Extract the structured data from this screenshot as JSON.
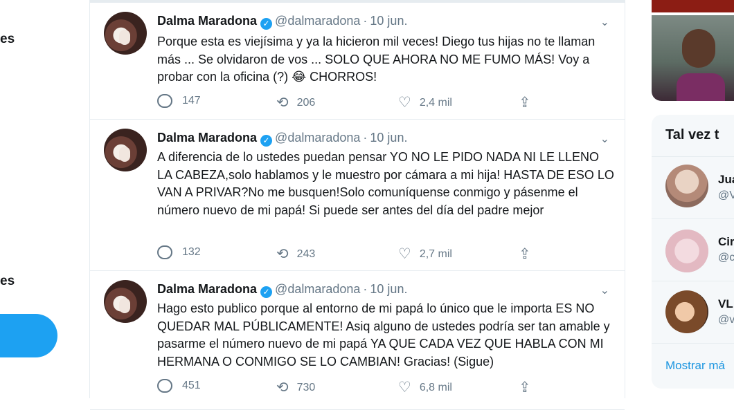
{
  "nav": {
    "partial_label_1": "es",
    "partial_label_2": "es"
  },
  "tweets": [
    {
      "name": "Dalma Maradona",
      "handle": "@dalmaradona",
      "date": "10 jun.",
      "text": "Porque esta es viejísima y ya la hicieron mil veces! Diego tus hijas no te llaman más ... Se olvidaron de vos ... SOLO QUE AHORA NO ME FUMO MÁS! Voy a probar con la oficina (?) 😂 CHORROS!",
      "replies": "147",
      "retweets": "206",
      "likes": "2,4 mil"
    },
    {
      "name": "Dalma Maradona",
      "handle": "@dalmaradona",
      "date": "10 jun.",
      "text": "A diferencia de lo ustedes puedan pensar YO NO LE PIDO NADA NI LE LLENO LA CABEZA,solo hablamos y le muestro por cámara a mi hija! HASTA DE ESO LO VAN A PRIVAR?No me busquen!Solo comuníquense conmigo y pásenme el número nuevo de mi papá! Si puede ser antes del día del padre mejor",
      "replies": "132",
      "retweets": "243",
      "likes": "2,7 mil"
    },
    {
      "name": "Dalma Maradona",
      "handle": "@dalmaradona",
      "date": "10 jun.",
      "text": "Hago esto publico porque al entorno de mi papá lo único que le importa ES NO QUEDAR MAL PÚBLICAMENTE! Asiq alguno de ustedes podría ser tan amable y pasarme el número nuevo de mi papá YA QUE CADA VEZ QUE HABLA CON MI HERMANA O CONMIGO SE LO CAMBIAN! Gracias! (Sigue)",
      "replies": "451",
      "retweets": "730",
      "likes": "6,8 mil"
    }
  ],
  "who_to_follow": {
    "title": "Tal vez t",
    "items": [
      {
        "name": "Jua",
        "handle": "@V"
      },
      {
        "name": "Cir",
        "handle": "@c"
      },
      {
        "name": "VL",
        "handle": "@v"
      }
    ],
    "more": "Mostrar má"
  },
  "colors": {
    "accent": "#1da1f2",
    "link": "#1b95e0",
    "muted": "#657786",
    "border": "#e6ecf0"
  }
}
